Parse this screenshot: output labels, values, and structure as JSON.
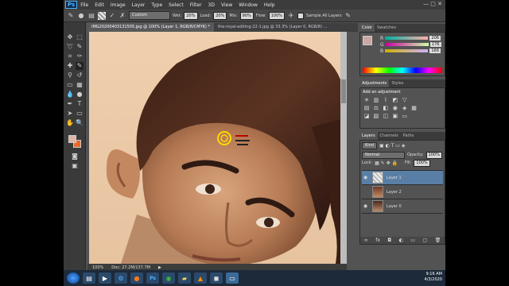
{
  "app": {
    "logo": "Ps",
    "menu": [
      "File",
      "Edit",
      "Image",
      "Layer",
      "Type",
      "Select",
      "Filter",
      "3D",
      "View",
      "Window",
      "Help"
    ]
  },
  "options_bar": {
    "preset": "Custom",
    "wet_label": "Wet:",
    "wet_value": "20%",
    "load_label": "Load:",
    "load_value": "20%",
    "mix_label": "Mix:",
    "mix_value": "90%",
    "flow_label": "Flow:",
    "flow_value": "100%",
    "sample_label": "Sample All Layers"
  },
  "tabs": [
    {
      "label": "IMG20200403131505.jpg @ 100% (Layer 1, RGB/8/CMYK) *",
      "active": true
    },
    {
      "label": "the-royal-editing-22-1.jpg @ 33.3% (Layer 0, RGB/8) ...",
      "active": false
    }
  ],
  "status": {
    "zoom": "100%",
    "doc": "Doc: 27.2M/137.7M"
  },
  "color_panel": {
    "tabs": [
      "Color",
      "Swatches"
    ],
    "r_label": "R",
    "r_value": "206",
    "g_label": "G",
    "g_value": "176",
    "b_label": "B",
    "b_value": "166",
    "fg_color": "#cea6a6"
  },
  "adjustments_panel": {
    "tabs": [
      "Adjustments",
      "Styles"
    ],
    "heading": "Add an adjustment"
  },
  "layers_panel": {
    "tabs": [
      "Layers",
      "Channels",
      "Paths"
    ],
    "kind": "Kind",
    "blend_mode": "Normal",
    "opacity_label": "Opacity:",
    "opacity_value": "100%",
    "lock_label": "Lock:",
    "fill_label": "Fill:",
    "fill_value": "100%",
    "layers": [
      {
        "name": "Layer 1",
        "selected": true
      },
      {
        "name": "Layer 2",
        "selected": false
      },
      {
        "name": "Layer 0",
        "selected": false
      }
    ]
  },
  "taskbar": {
    "time": "9:16 AM",
    "date": "4/3/2020"
  },
  "colors": {
    "accent": "#5a7fa6",
    "foreground_swatch": "#e0b5a5",
    "background_swatch": "#e86a2a"
  }
}
